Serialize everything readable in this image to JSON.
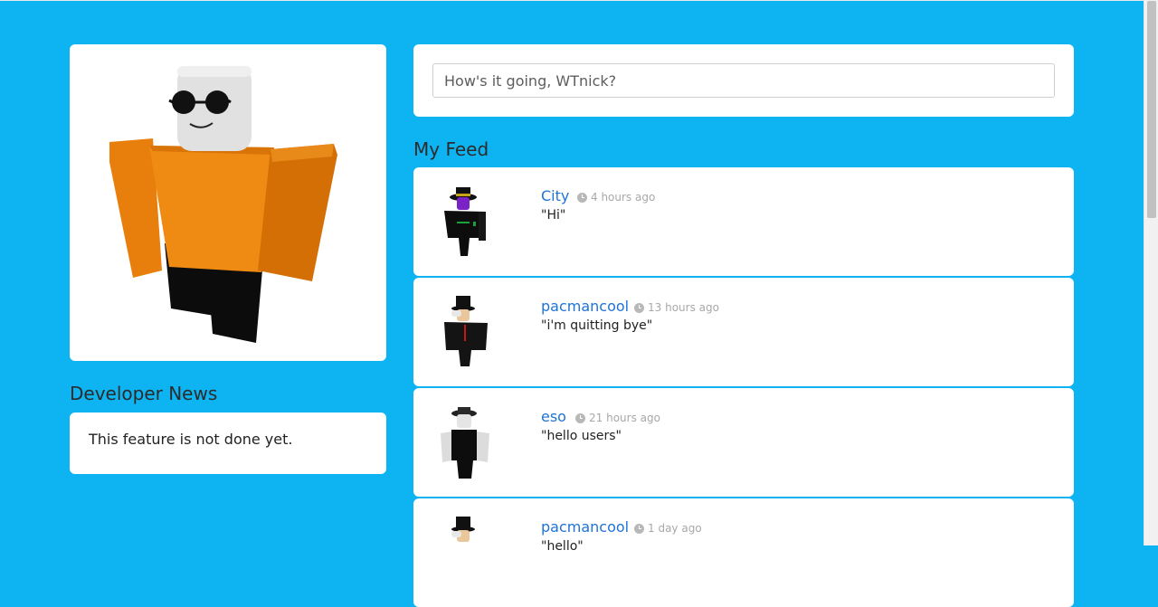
{
  "status": {
    "placeholder": "How's it going, WTnick?"
  },
  "developer_news": {
    "title": "Developer News",
    "message": "This feature is not done yet."
  },
  "feed": {
    "title": "My Feed",
    "items": [
      {
        "user": "City",
        "time": "4 hours ago",
        "text": "\"Hi\""
      },
      {
        "user": "pacmancool",
        "time": "13 hours ago",
        "text": "\"i'm quitting bye\""
      },
      {
        "user": "eso",
        "time": "21 hours ago",
        "text": "\"hello users\""
      },
      {
        "user": "pacmancool",
        "time": "1 day ago",
        "text": "\"hello\""
      }
    ]
  },
  "colors": {
    "background": "#0db4f1",
    "link": "#1e73d8"
  }
}
